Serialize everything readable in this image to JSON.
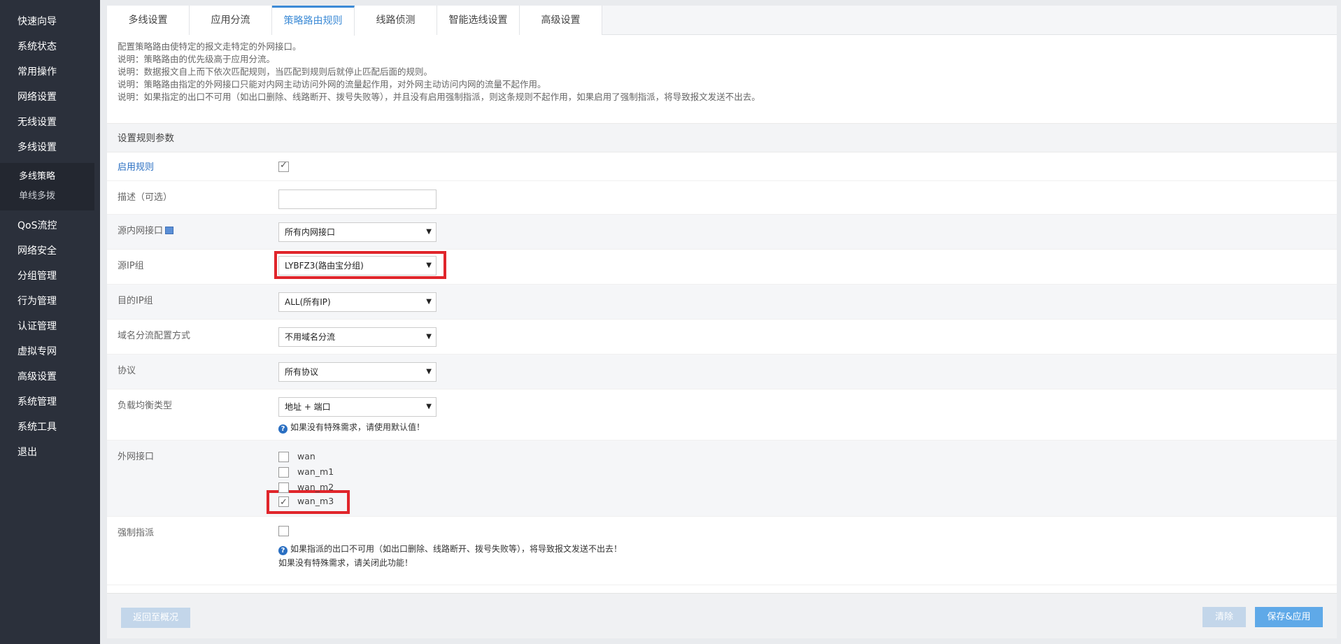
{
  "sidebar": {
    "items_top": [
      "快速向导",
      "系统状态",
      "常用操作",
      "网络设置",
      "无线设置",
      "多线设置"
    ],
    "submenu": [
      "多线策略",
      "单线多拨"
    ],
    "items_bottom": [
      "QoS流控",
      "网络安全",
      "分组管理",
      "行为管理",
      "认证管理",
      "虚拟专网",
      "高级设置",
      "系统管理",
      "系统工具",
      "退出"
    ]
  },
  "tabs": [
    "多线设置",
    "应用分流",
    "策略路由规则",
    "线路侦测",
    "智能选线设置",
    "高级设置"
  ],
  "notes": [
    "配置策略路由使特定的报文走特定的外网接口。",
    "说明：策略路由的优先级高于应用分流。",
    "说明：数据报文自上而下依次匹配规则，当匹配到规则后就停止匹配后面的规则。",
    "说明：策略路由指定的外网接口只能对内网主动访问外网的流量起作用，对外网主动访问内网的流量不起作用。",
    "说明：如果指定的出口不可用（如出口删除、线路断开、拨号失败等），并且没有启用强制指派，则这条规则不起作用，如果启用了强制指派，将导致报文发送不出去。"
  ],
  "section_title": "设置规则参数",
  "form": {
    "enable_label": "启用规则",
    "desc_label": "描述（可选）",
    "src_iface_label": "源内网接口",
    "src_iface_value": "所有内网接口",
    "src_ip_label": "源IP组",
    "src_ip_value": "LYBFZ3(路由宝分组)",
    "dst_ip_label": "目的IP组",
    "dst_ip_value": "ALL(所有IP)",
    "domain_label": "域名分流配置方式",
    "domain_value": "不用域名分流",
    "proto_label": "协议",
    "proto_value": "所有协议",
    "lb_label": "负载均衡类型",
    "lb_value": "地址 + 端口",
    "lb_help": "如果没有特殊需求，请使用默认值！",
    "wan_label": "外网接口",
    "wan_items": [
      "wan",
      "wan_m1",
      "wan_m2",
      "wan_m3"
    ],
    "force_label": "强制指派",
    "force_help_1": "如果指派的出口不可用（如出口删除、线路断开、拨号失败等），将导致报文发送不出去！",
    "force_help_2": "如果没有特殊需求，请关闭此功能！"
  },
  "buttons": {
    "back": "返回至概况",
    "clear": "清除",
    "save": "保存&应用"
  },
  "colors": {
    "sidebar_bg": "#2b303b",
    "accent": "#3d8bd6",
    "highlight": "#e0252b"
  }
}
